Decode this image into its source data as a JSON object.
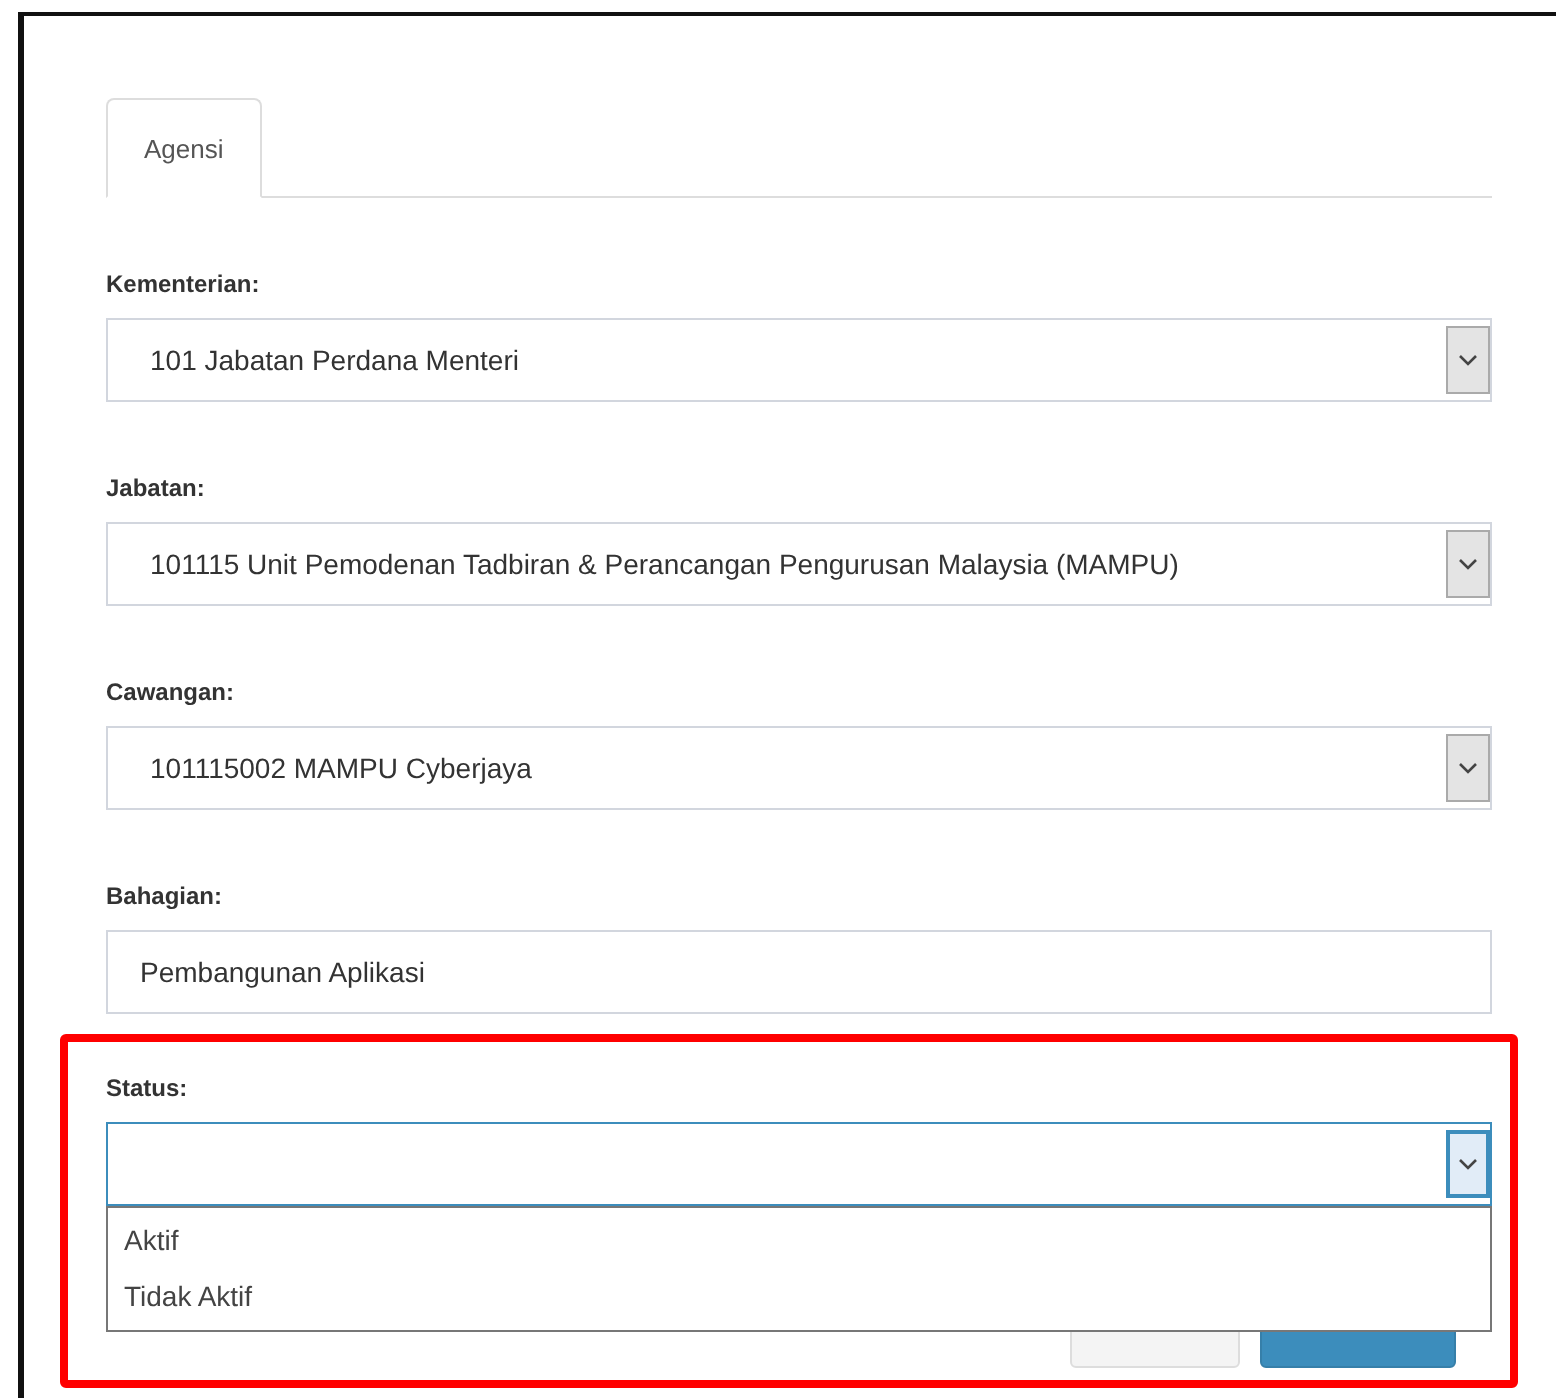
{
  "tabs": [
    {
      "label": "Agensi",
      "selected": true
    }
  ],
  "fields": [
    {
      "label": "Kementerian:",
      "kind": "select",
      "value": "101 Jabatan Perdana Menteri",
      "focused": false
    },
    {
      "label": "Jabatan:",
      "kind": "select",
      "value": "101115 Unit Pemodenan Tadbiran & Perancangan Pengurusan Malaysia (MAMPU)",
      "focused": false
    },
    {
      "label": "Cawangan:",
      "kind": "select",
      "value": "101115002 MAMPU Cyberjaya",
      "focused": false
    },
    {
      "label": "Bahagian:",
      "kind": "text",
      "value": "Pembangunan Aplikasi",
      "focused": false
    },
    {
      "label": "Status:",
      "kind": "select",
      "focused": true,
      "expanded": true,
      "options": [
        {
          "label": "Aktif",
          "selected": false
        },
        {
          "label": "Tidak Aktif",
          "selected": false
        }
      ]
    }
  ],
  "buttons": [
    {
      "kind": "default"
    },
    {
      "kind": "primary"
    }
  ]
}
